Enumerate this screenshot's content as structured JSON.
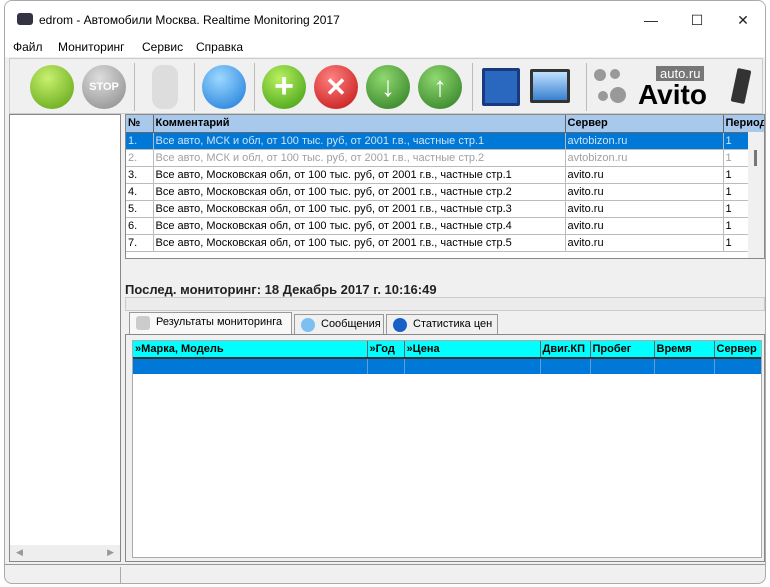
{
  "window": {
    "title": "edrom - Автомобили Москва. Realtime Monitoring 2017",
    "minimize": "—",
    "maximize": "☐",
    "close": "✕"
  },
  "menu": [
    "Файл",
    "Мониторинг",
    "Сервис",
    "Справка"
  ],
  "toolbar": {
    "buttons": [
      "start-car",
      "stop",
      "walk",
      "settings",
      "add",
      "delete",
      "move-down",
      "move-up",
      "edit",
      "import"
    ],
    "logo_top": "auto.ru",
    "logo_main": "Avito"
  },
  "colors": {
    "selection": "#0078d7",
    "header1": "#a8c8ec",
    "header2": "#00ffff"
  },
  "tasks": {
    "columns": [
      "№",
      "Комментарий",
      "Сервер",
      "Период"
    ],
    "rows": [
      {
        "n": "1.",
        "comment": "Все авто, МСК и обл, от 100 тыс. руб, от 2001 г.в., частные стр.1",
        "server": "avtobizon.ru",
        "period": "1"
      },
      {
        "n": "2.",
        "comment": "Все авто, МСК и обл, от 100 тыс. руб, от 2001 г.в., частные стр.2",
        "server": "avtobizon.ru",
        "period": "1"
      },
      {
        "n": "3.",
        "comment": "Все авто, Московская обл, от 100 тыс. руб, от 2001 г.в., частные стр.1",
        "server": "avito.ru",
        "period": "1"
      },
      {
        "n": "4.",
        "comment": "Все авто, Московская обл, от 100 тыс. руб, от 2001 г.в., частные стр.2",
        "server": "avito.ru",
        "period": "1"
      },
      {
        "n": "5.",
        "comment": "Все авто, Московская обл, от 100 тыс. руб, от 2001 г.в., частные стр.3",
        "server": "avito.ru",
        "period": "1"
      },
      {
        "n": "6.",
        "comment": "Все авто, Московская обл, от 100 тыс. руб, от 2001 г.в., частные стр.4",
        "server": "avito.ru",
        "period": "1"
      },
      {
        "n": "7.",
        "comment": "Все авто, Московская обл, от 100 тыс. руб, от 2001 г.в., частные стр.5",
        "server": "avito.ru",
        "period": "1"
      }
    ]
  },
  "status": "Послед. мониторинг: 18 Декабрь 2017 г. 10:16:49",
  "tabs": [
    "Результаты мониторинга",
    "Сообщения",
    "Статистика цен"
  ],
  "results": {
    "columns": [
      "»Марка, Модель",
      "»Год",
      "»Цена",
      "Двиг.КП",
      "Пробег",
      "Время",
      "Сервер"
    ]
  }
}
